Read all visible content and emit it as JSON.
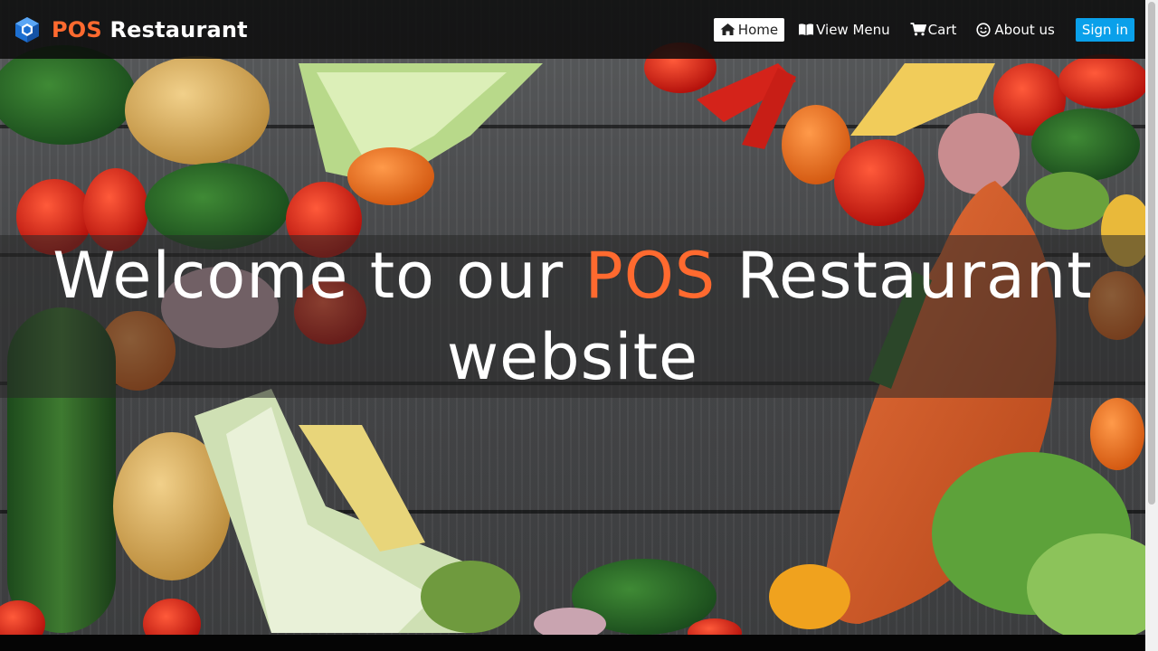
{
  "brand": {
    "accent": "POS",
    "name": "Restaurant",
    "accent_color": "#ff6a2f",
    "logo_icon": "cube-logo-icon"
  },
  "nav": {
    "items": [
      {
        "label": "Home",
        "icon": "home-icon",
        "active": true
      },
      {
        "label": "View Menu",
        "icon": "book-icon",
        "active": false
      },
      {
        "label": "Cart",
        "icon": "cart-icon",
        "active": false
      },
      {
        "label": "About us",
        "icon": "smile-icon",
        "active": false
      }
    ],
    "signin_label": "Sign in",
    "signin_color": "#0aa0ea"
  },
  "hero": {
    "headline_before": "Welcome to our",
    "headline_accent": "POS",
    "headline_after": "Restaurant",
    "headline_line2": "website"
  }
}
